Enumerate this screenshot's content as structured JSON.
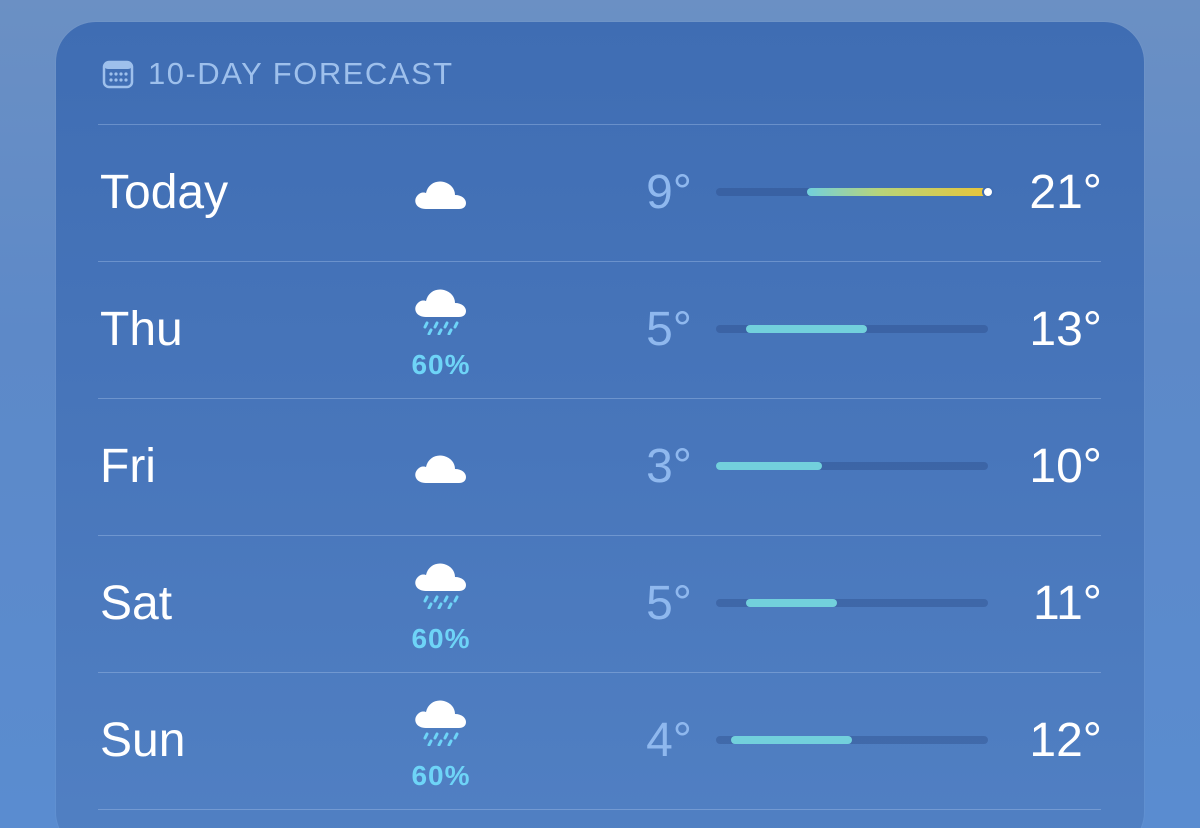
{
  "forecast": {
    "title": "10-DAY FORECAST",
    "header_icon": "calendar-icon",
    "bar_color": "#72d0dc",
    "bar_warm_color": "#e8c53a",
    "range": {
      "min": 3,
      "max": 21
    },
    "days": [
      {
        "day": "Today",
        "icon": "cloud-icon",
        "precip": "",
        "low_label": "9°",
        "high_label": "21°",
        "low": 9,
        "high": 21,
        "current": 21,
        "warm": true
      },
      {
        "day": "Thu",
        "icon": "cloud-rain-icon",
        "precip": "60%",
        "low_label": "5°",
        "high_label": "13°",
        "low": 5,
        "high": 13
      },
      {
        "day": "Fri",
        "icon": "cloud-icon",
        "precip": "",
        "low_label": "3°",
        "high_label": "10°",
        "low": 3,
        "high": 10
      },
      {
        "day": "Sat",
        "icon": "cloud-rain-icon",
        "precip": "60%",
        "low_label": "5°",
        "high_label": "11°",
        "low": 5,
        "high": 11
      },
      {
        "day": "Sun",
        "icon": "cloud-rain-icon",
        "precip": "60%",
        "low_label": "4°",
        "high_label": "12°",
        "low": 4,
        "high": 12
      }
    ]
  }
}
